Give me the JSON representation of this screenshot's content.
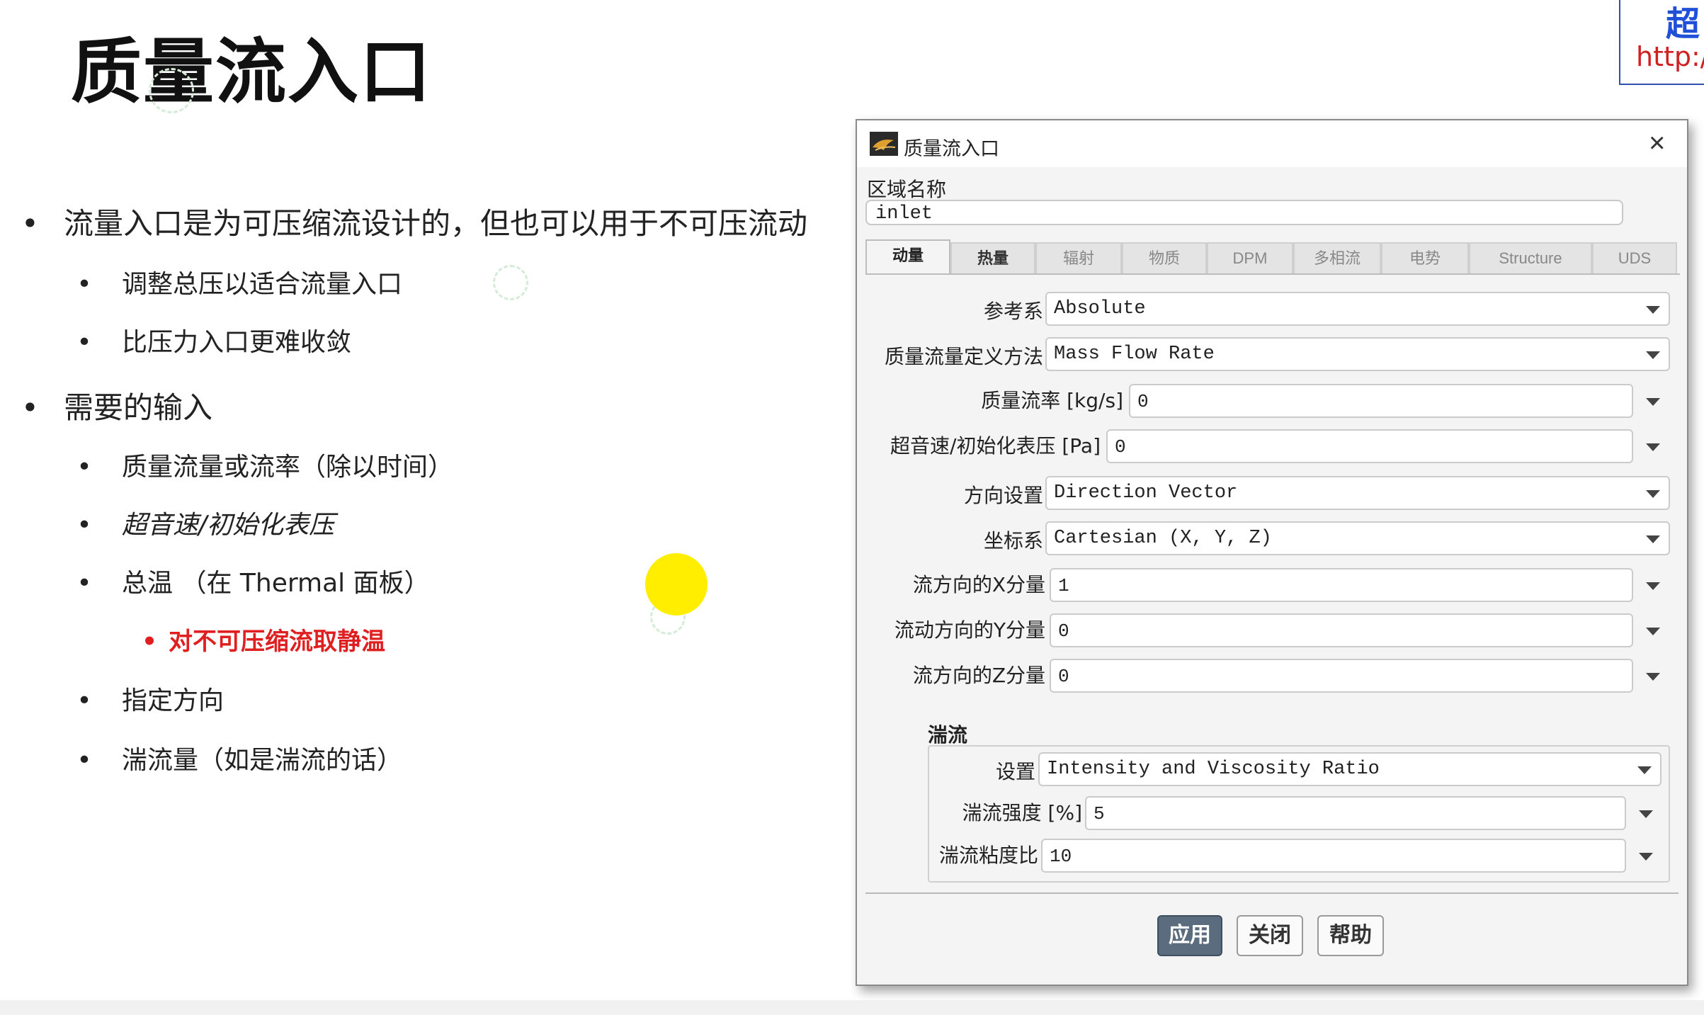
{
  "slide": {
    "title": "质量流入口",
    "bullets": [
      {
        "level": 1,
        "text": "流量入口是为可压缩流设计的，但也可以用于不可压流动"
      },
      {
        "level": 2,
        "text": "调整总压以适合流量入口"
      },
      {
        "level": 2,
        "text": "比压力入口更难收敛"
      },
      {
        "level": 1,
        "text": "需要的输入"
      },
      {
        "level": 2,
        "text": "质量流量或流率（除以时间）"
      },
      {
        "level": 2,
        "text": "超音速/初始化表压",
        "italic": true
      },
      {
        "level": 2,
        "text": "总温  （在 Thermal 面板）"
      },
      {
        "level": 3,
        "text": "对不可压缩流取静温",
        "color": "#e02020"
      },
      {
        "level": 2,
        "text": "指定方向"
      },
      {
        "level": 2,
        "text": "湍流量（如是湍流的话）"
      }
    ],
    "bullet_char": "•"
  },
  "watermark": {
    "line1": "超",
    "line2": "http:/"
  },
  "dialog": {
    "title": "质量流入口",
    "zone_label": "区域名称",
    "zone_value": "inlet",
    "tabs": [
      "动量",
      "热量",
      "辐射",
      "物质",
      "DPM",
      "多相流",
      "电势",
      "Structure",
      "UDS"
    ],
    "active_tab": "动量",
    "fields": {
      "ref_frame": {
        "label": "参考系",
        "value": "Absolute"
      },
      "mass_flow_method": {
        "label": "质量流量定义方法",
        "value": "Mass Flow Rate"
      },
      "mass_flow_rate": {
        "label": "质量流率 [kg/s]",
        "value": "0"
      },
      "gauge_pressure": {
        "label": "超音速/初始化表压 [Pa]",
        "value": "0"
      },
      "direction_spec": {
        "label": "方向设置",
        "value": "Direction Vector"
      },
      "coord_system": {
        "label": "坐标系",
        "value": "Cartesian (X, Y, Z)"
      },
      "x_component": {
        "label": "流方向的X分量",
        "value": "1"
      },
      "y_component": {
        "label": "流动方向的Y分量",
        "value": "0"
      },
      "z_component": {
        "label": "流方向的Z分量",
        "value": "0"
      }
    },
    "turbulence": {
      "title": "湍流",
      "method": {
        "label": "设置",
        "value": "Intensity and Viscosity Ratio"
      },
      "intensity": {
        "label": "湍流强度 [%]",
        "value": "5"
      },
      "viscosity_ratio": {
        "label": "湍流粘度比",
        "value": "10"
      }
    },
    "buttons": {
      "apply": "应用",
      "close": "关闭",
      "help": "帮助"
    },
    "close_glyph": "×"
  },
  "colors": {
    "highlight_red": "#e02020",
    "pointer_yellow": "#ffee00",
    "primary_button": "#5a6c7e"
  }
}
